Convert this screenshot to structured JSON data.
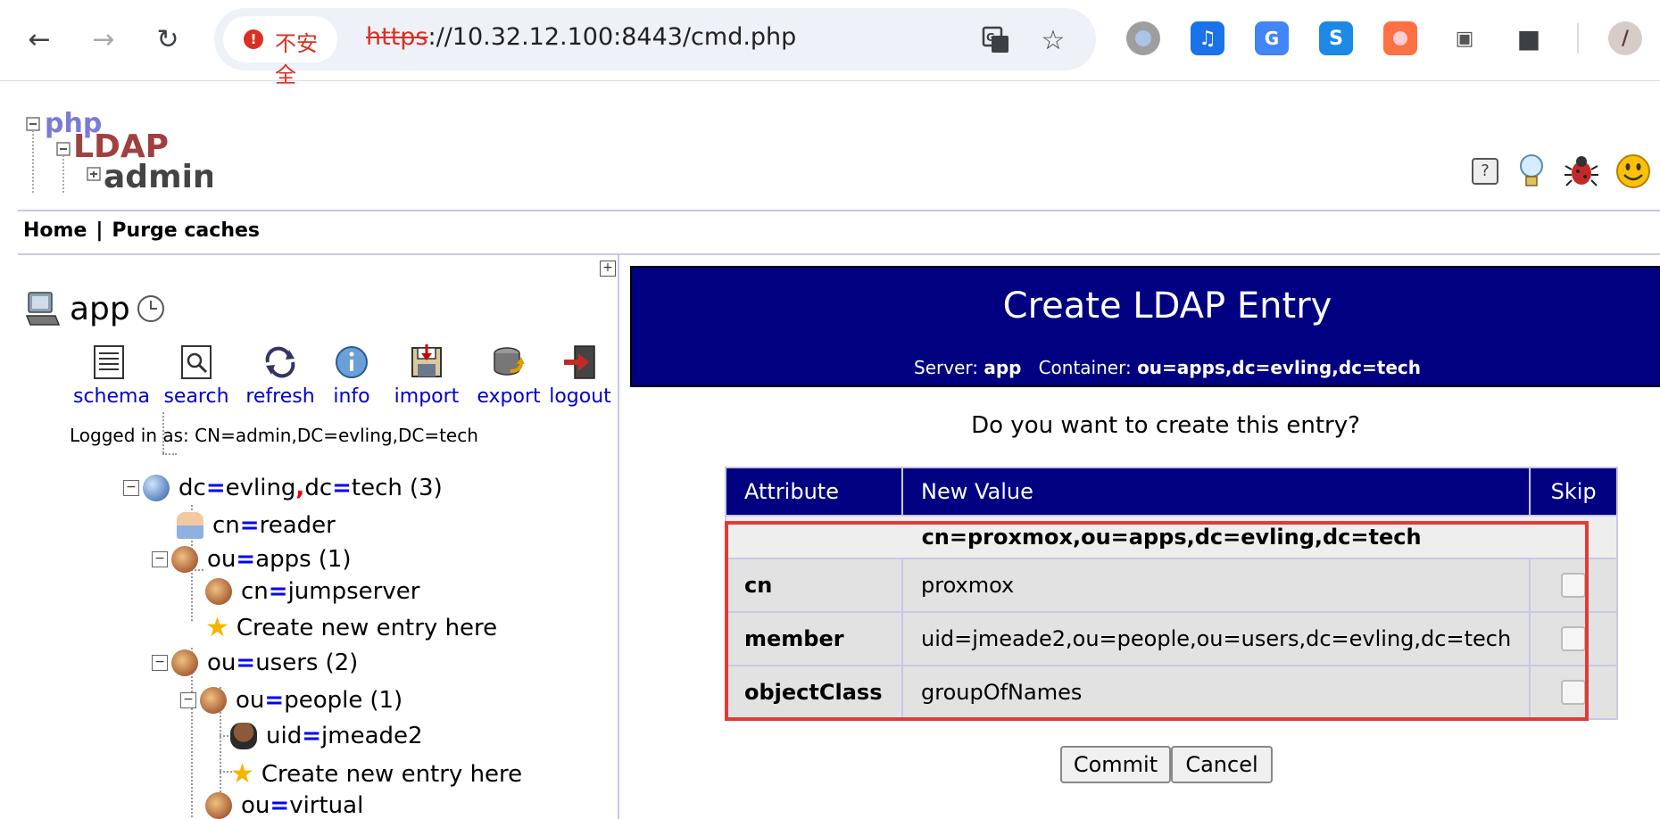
{
  "browser": {
    "security_label": "不安全",
    "url_scheme": "https",
    "url_rest": "://10.32.12.100:8443/cmd.php"
  },
  "header": {
    "logo_text": [
      "php",
      "LDAP",
      "admin"
    ],
    "menu": {
      "home": "Home",
      "separator": "|",
      "purge": "Purge caches"
    }
  },
  "sidebar": {
    "server_name": "app",
    "tools": [
      {
        "label": "schema"
      },
      {
        "label": "search"
      },
      {
        "label": "refresh"
      },
      {
        "label": "info"
      },
      {
        "label": "import"
      },
      {
        "label": "export"
      },
      {
        "label": "logout"
      }
    ],
    "logged_in": "Logged in as: CN=admin,DC=evling,DC=tech",
    "tree": {
      "root": {
        "k1": "dc",
        "v1": "evling",
        "comma": ",",
        "k2": "dc",
        "v2": "tech",
        "count": "(3)"
      },
      "reader": {
        "k": "cn",
        "v": "reader"
      },
      "apps": {
        "k": "ou",
        "v": "apps",
        "count": "(1)"
      },
      "jumpserver": {
        "k": "cn",
        "v": "jumpserver"
      },
      "create1": "Create new entry here",
      "users": {
        "k": "ou",
        "v": "users",
        "count": "(2)"
      },
      "people": {
        "k": "ou",
        "v": "people",
        "count": "(1)"
      },
      "jmeade": {
        "k": "uid",
        "v": "jmeade2"
      },
      "create2": "Create new entry here",
      "virtual": {
        "k": "ou",
        "v": "virtual"
      }
    }
  },
  "main": {
    "title": "Create LDAP Entry",
    "server_label": "Server:",
    "server_value": "app",
    "container_label": "Container:",
    "container_value": "ou=apps,dc=evling,dc=tech",
    "question": "Do you want to create this entry?",
    "table": {
      "headers": [
        "Attribute",
        "New Value",
        "Skip"
      ],
      "dn": "cn=proxmox,ou=apps,dc=evling,dc=tech",
      "rows": [
        {
          "attr": "cn",
          "value": "proxmox"
        },
        {
          "attr": "member",
          "value": "uid=jmeade2,ou=people,ou=users,dc=evling,dc=tech"
        },
        {
          "attr": "objectClass",
          "value": "groupOfNames"
        }
      ]
    },
    "commit": "Commit",
    "cancel": "Cancel"
  }
}
